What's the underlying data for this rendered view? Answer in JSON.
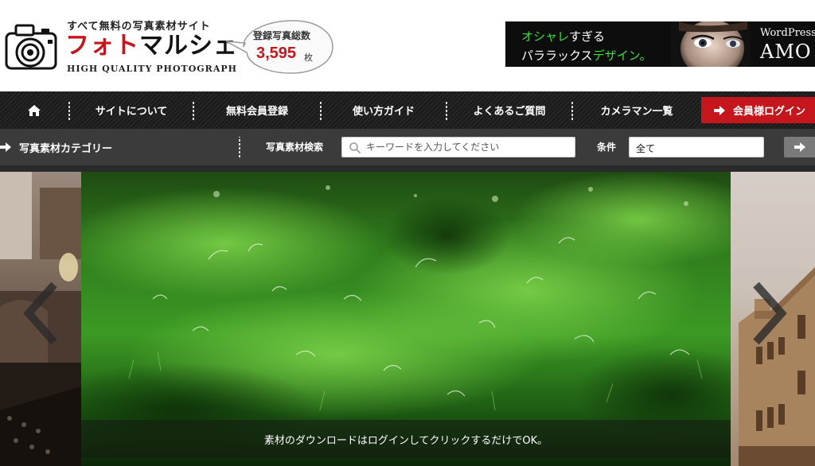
{
  "header": {
    "tagline": "すべて無料の写真素材サイト",
    "site_name_red": "フォト",
    "site_name_black": "マルシェ",
    "site_subtitle": "HIGH QUALITY PHOTOGRAPH",
    "counter": {
      "label": "登録写真総数",
      "count": "3,595",
      "unit": "枚"
    },
    "ad": {
      "line1_green": "オシャレ",
      "line1_white": "すぎる",
      "line2_white": "パララックス",
      "line2_green": "デザイン。",
      "brand1": "WordPress",
      "brand2": "AMO"
    }
  },
  "nav": {
    "home_icon": "home-icon",
    "items": [
      {
        "label": "サイトについて"
      },
      {
        "label": "無料会員登録"
      },
      {
        "label": "使い方ガイド"
      },
      {
        "label": "よくあるご質問"
      },
      {
        "label": "カメラマン一覧"
      }
    ],
    "login_label": "会員様ログイン",
    "login_color": "#c4161c"
  },
  "search": {
    "category_label": "写真素材カテゴリー",
    "search_label": "写真素材検索",
    "placeholder": "キーワードを入力してください",
    "condition_label": "条件",
    "condition_value": "全て"
  },
  "slider": {
    "caption": "素材のダウンロードはログインしてクリックするだけでOK。",
    "prev_icon": "chevron-left-icon",
    "next_icon": "chevron-right-icon"
  }
}
